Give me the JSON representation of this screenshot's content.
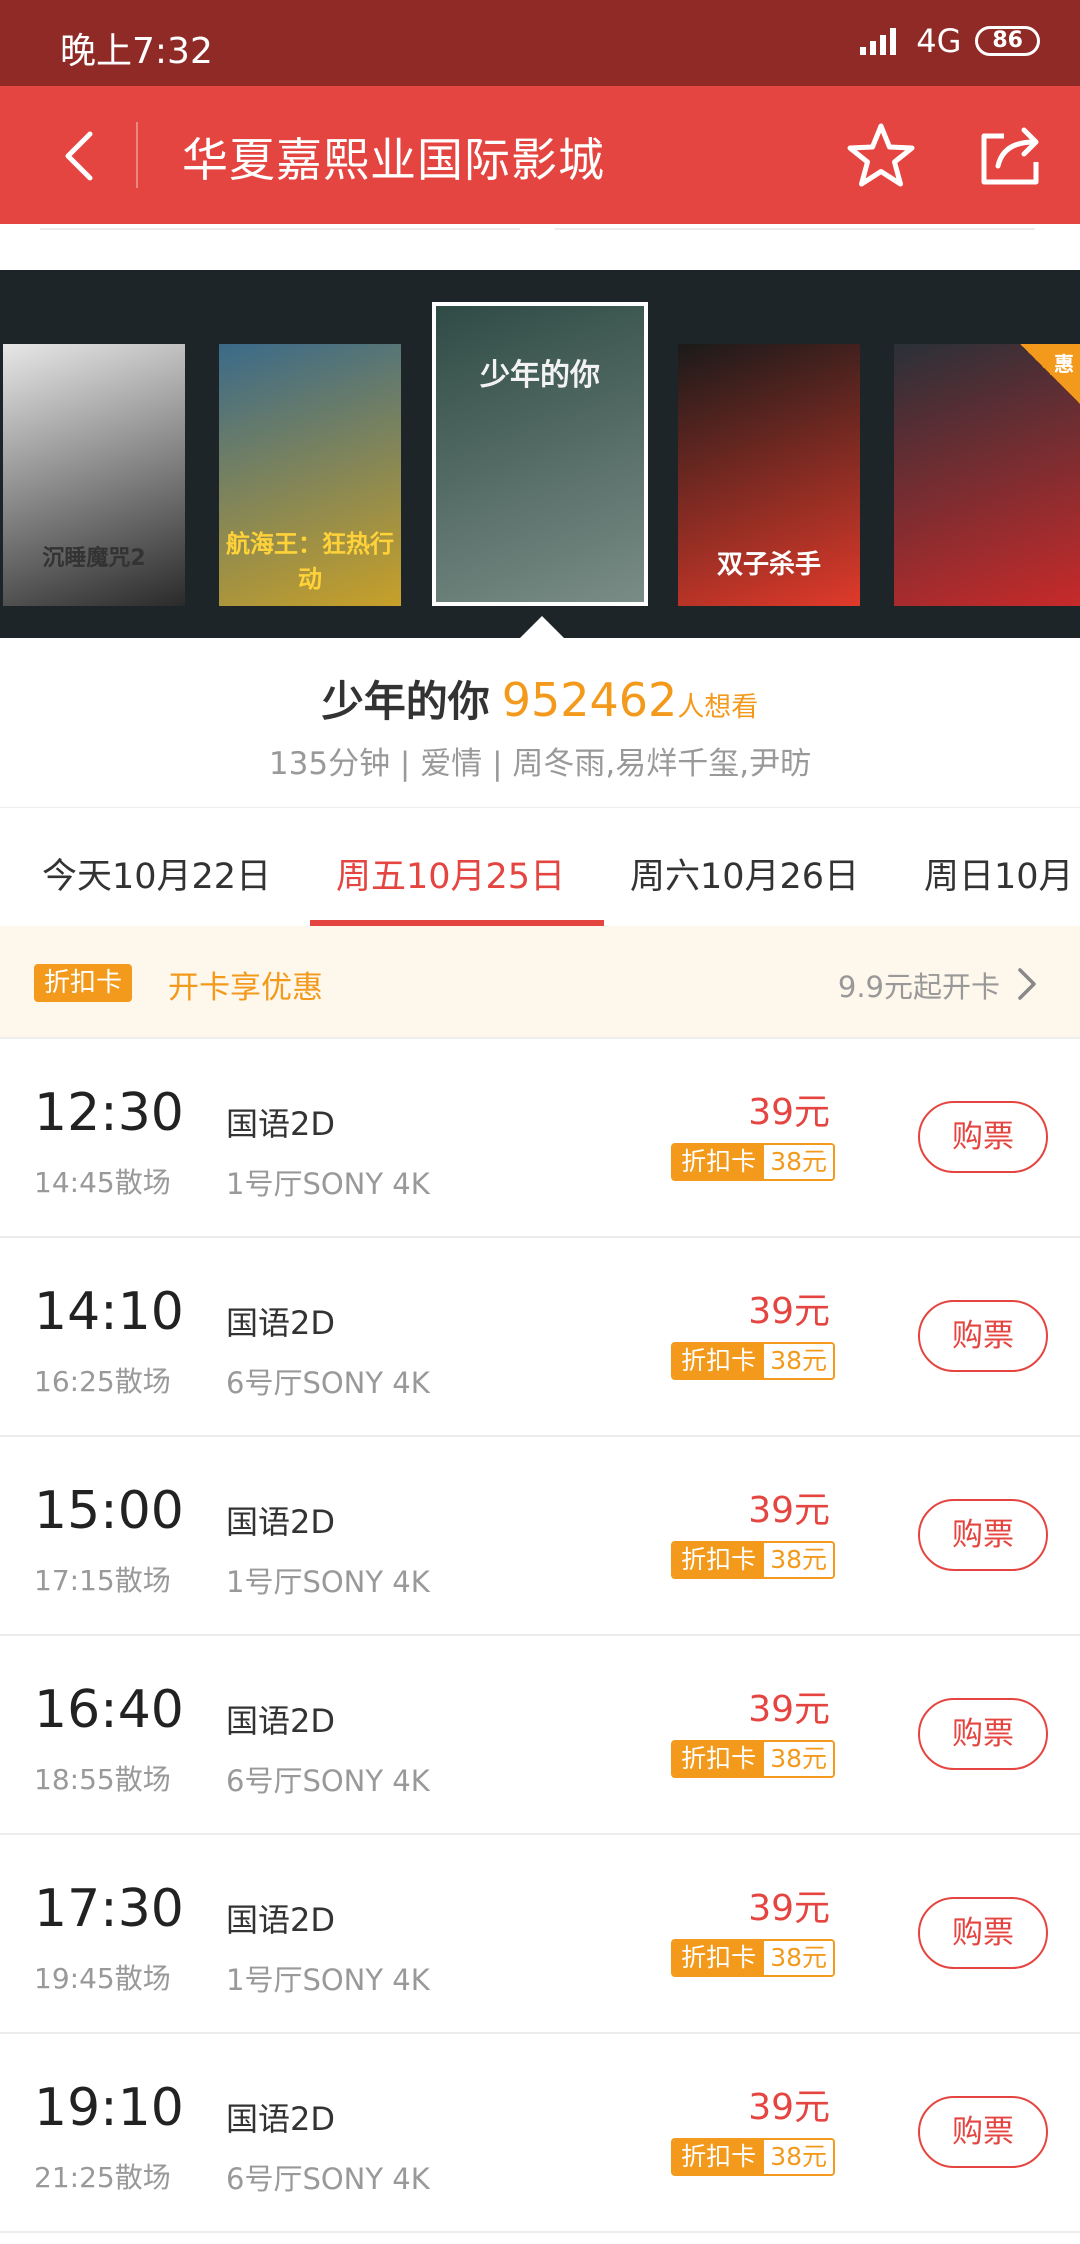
{
  "status_bar": {
    "time": "晚上7:32",
    "network": "4G",
    "battery": "86"
  },
  "header": {
    "title": "华夏嘉熙业国际影城"
  },
  "posters": [
    {
      "text": "沉睡魔咒2",
      "colors": [
        "#e7e7e7",
        "#2a2a2a"
      ]
    },
    {
      "text": "航海王：狂热行动",
      "colors": [
        "#3a6a8a",
        "#c8a028"
      ]
    },
    {
      "text": "少年的你",
      "colors": [
        "#2f4b45",
        "#7a8c86"
      ]
    },
    {
      "text": "双子杀手",
      "colors": [
        "#1a1a1a",
        "#e03a2a"
      ]
    },
    {
      "text": "惠",
      "colors": [
        "#2a3038",
        "#c82a2a"
      ]
    }
  ],
  "movie": {
    "name": "少年的你",
    "want_count": "952462",
    "want_label": "人想看",
    "meta": "135分钟 | 爱情 | 周冬雨,易烊千玺,尹昉"
  },
  "date_tabs": [
    {
      "label": "今天10月22日"
    },
    {
      "label": "周五10月25日"
    },
    {
      "label": "周六10月26日"
    },
    {
      "label": "周日10月"
    }
  ],
  "discount": {
    "badge": "折扣卡",
    "text": "开卡享优惠",
    "right": "9.9元起开卡"
  },
  "showtimes": [
    {
      "start": "12:30",
      "end": "14:45散场",
      "lang": "国语2D",
      "hall": "1号厅SONY 4K",
      "price": "39元",
      "card_label": "折扣卡",
      "card_price": "38元",
      "buy": "购票"
    },
    {
      "start": "14:10",
      "end": "16:25散场",
      "lang": "国语2D",
      "hall": "6号厅SONY 4K",
      "price": "39元",
      "card_label": "折扣卡",
      "card_price": "38元",
      "buy": "购票"
    },
    {
      "start": "15:00",
      "end": "17:15散场",
      "lang": "国语2D",
      "hall": "1号厅SONY 4K",
      "price": "39元",
      "card_label": "折扣卡",
      "card_price": "38元",
      "buy": "购票"
    },
    {
      "start": "16:40",
      "end": "18:55散场",
      "lang": "国语2D",
      "hall": "6号厅SONY 4K",
      "price": "39元",
      "card_label": "折扣卡",
      "card_price": "38元",
      "buy": "购票"
    },
    {
      "start": "17:30",
      "end": "19:45散场",
      "lang": "国语2D",
      "hall": "1号厅SONY 4K",
      "price": "39元",
      "card_label": "折扣卡",
      "card_price": "38元",
      "buy": "购票"
    },
    {
      "start": "19:10",
      "end": "21:25散场",
      "lang": "国语2D",
      "hall": "6号厅SONY 4K",
      "price": "39元",
      "card_label": "折扣卡",
      "card_price": "38元",
      "buy": "购票"
    }
  ],
  "colors": {
    "brand_red": "#e54540",
    "status_bar": "#8f2a26",
    "accent_orange": "#f39a1c"
  }
}
